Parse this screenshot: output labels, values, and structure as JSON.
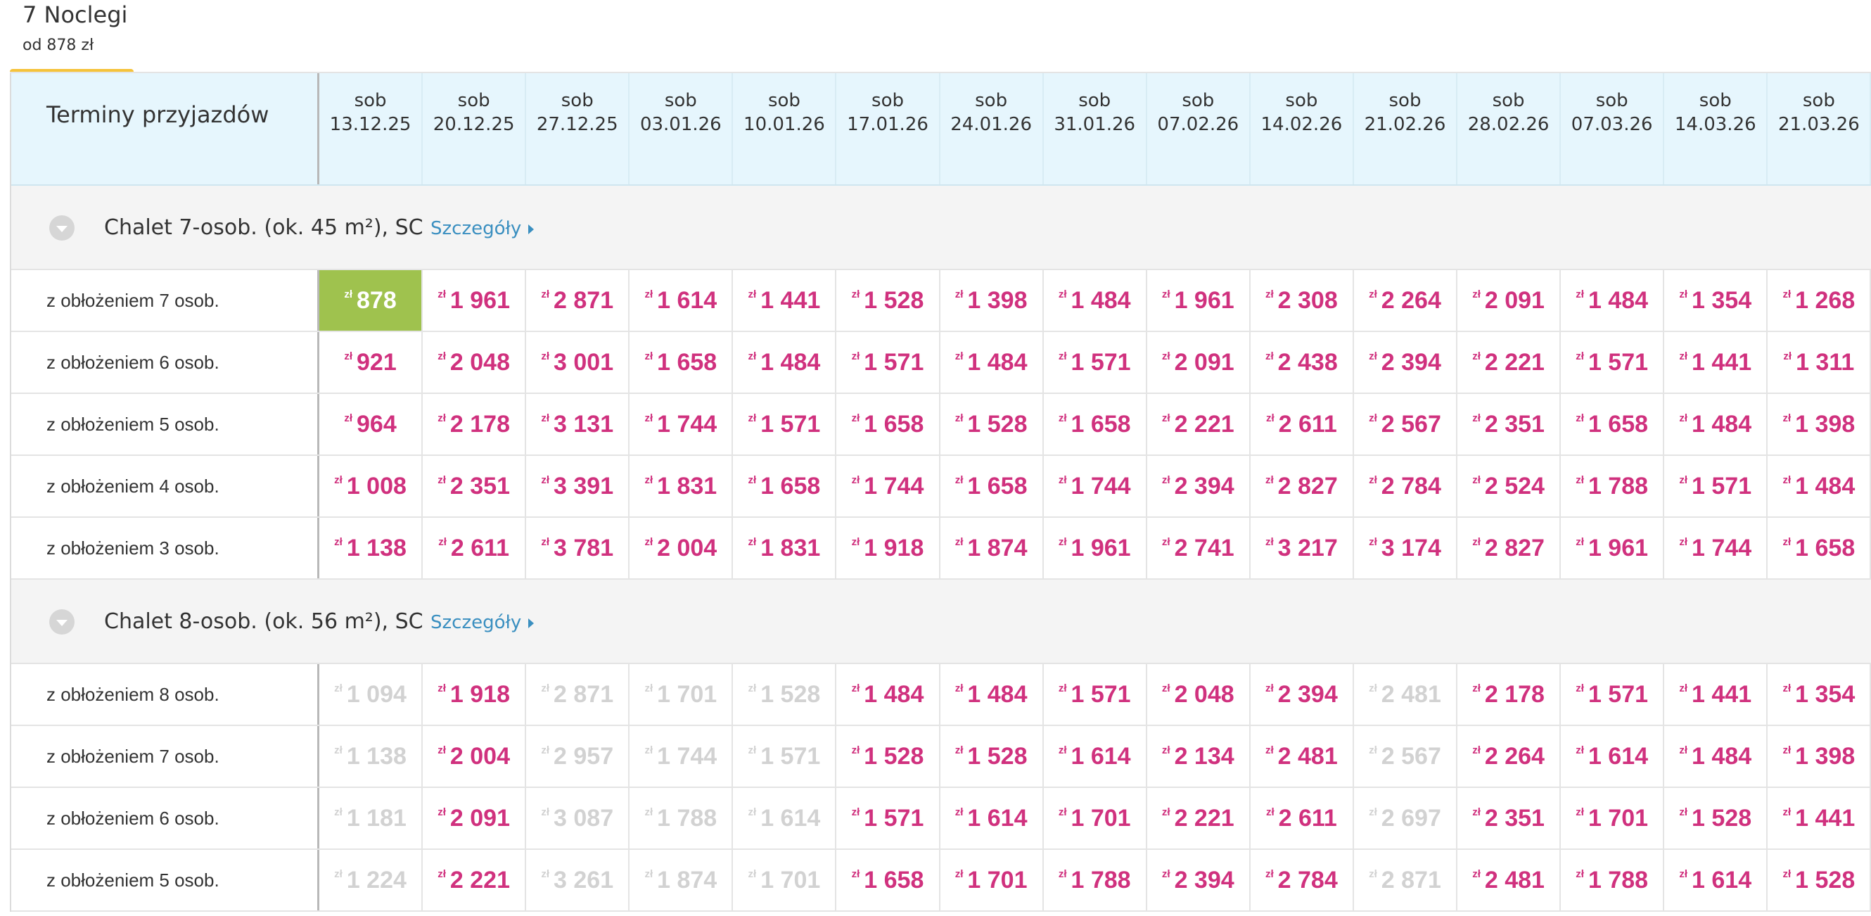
{
  "tab": {
    "title": "7 Noclegi",
    "subtitle": "od 878 zł"
  },
  "colors": {
    "tab_accent": "#f5c33b",
    "price_available": "#d0317e",
    "price_unavailable": "#d2d2d2",
    "best_price_bg": "#9fc24e",
    "header_bg": "#e6f6fd",
    "link": "#3a8fc0"
  },
  "table": {
    "header_label": "Terminy przyjazdów",
    "dates": [
      {
        "day": "sob",
        "date": "13.12.25"
      },
      {
        "day": "sob",
        "date": "20.12.25"
      },
      {
        "day": "sob",
        "date": "27.12.25"
      },
      {
        "day": "sob",
        "date": "03.01.26"
      },
      {
        "day": "sob",
        "date": "10.01.26"
      },
      {
        "day": "sob",
        "date": "17.01.26"
      },
      {
        "day": "sob",
        "date": "24.01.26"
      },
      {
        "day": "sob",
        "date": "31.01.26"
      },
      {
        "day": "sob",
        "date": "07.02.26"
      },
      {
        "day": "sob",
        "date": "14.02.26"
      },
      {
        "day": "sob",
        "date": "21.02.26"
      },
      {
        "day": "sob",
        "date": "28.02.26"
      },
      {
        "day": "sob",
        "date": "07.03.26"
      },
      {
        "day": "sob",
        "date": "14.03.26"
      },
      {
        "day": "sob",
        "date": "21.03.26"
      }
    ],
    "currency": "zł",
    "groups": [
      {
        "title": "Chalet 7-osob. (ok. 45 m²), SC",
        "details_label": "Szczegóły",
        "collapse_icon": "chevron-down-icon",
        "rows": [
          {
            "label": "z obłożeniem 7 osob.",
            "prices": [
              "878",
              "1 961",
              "2 871",
              "1 614",
              "1 441",
              "1 528",
              "1 398",
              "1 484",
              "1 961",
              "2 308",
              "2 264",
              "2 091",
              "1 484",
              "1 354",
              "1 268"
            ],
            "available": [
              1,
              1,
              1,
              1,
              1,
              1,
              1,
              1,
              1,
              1,
              1,
              1,
              1,
              1,
              1
            ],
            "best": 0
          },
          {
            "label": "z obłożeniem 6 osob.",
            "prices": [
              "921",
              "2 048",
              "3 001",
              "1 658",
              "1 484",
              "1 571",
              "1 484",
              "1 571",
              "2 091",
              "2 438",
              "2 394",
              "2 221",
              "1 571",
              "1 441",
              "1 311"
            ],
            "available": [
              1,
              1,
              1,
              1,
              1,
              1,
              1,
              1,
              1,
              1,
              1,
              1,
              1,
              1,
              1
            ]
          },
          {
            "label": "z obłożeniem 5 osob.",
            "prices": [
              "964",
              "2 178",
              "3 131",
              "1 744",
              "1 571",
              "1 658",
              "1 528",
              "1 658",
              "2 221",
              "2 611",
              "2 567",
              "2 351",
              "1 658",
              "1 484",
              "1 398"
            ],
            "available": [
              1,
              1,
              1,
              1,
              1,
              1,
              1,
              1,
              1,
              1,
              1,
              1,
              1,
              1,
              1
            ]
          },
          {
            "label": "z obłożeniem 4 osob.",
            "prices": [
              "1 008",
              "2 351",
              "3 391",
              "1 831",
              "1 658",
              "1 744",
              "1 658",
              "1 744",
              "2 394",
              "2 827",
              "2 784",
              "2 524",
              "1 788",
              "1 571",
              "1 484"
            ],
            "available": [
              1,
              1,
              1,
              1,
              1,
              1,
              1,
              1,
              1,
              1,
              1,
              1,
              1,
              1,
              1
            ]
          },
          {
            "label": "z obłożeniem 3 osob.",
            "prices": [
              "1 138",
              "2 611",
              "3 781",
              "2 004",
              "1 831",
              "1 918",
              "1 874",
              "1 961",
              "2 741",
              "3 217",
              "3 174",
              "2 827",
              "1 961",
              "1 744",
              "1 658"
            ],
            "available": [
              1,
              1,
              1,
              1,
              1,
              1,
              1,
              1,
              1,
              1,
              1,
              1,
              1,
              1,
              1
            ]
          }
        ]
      },
      {
        "title": "Chalet 8-osob. (ok. 56 m²), SC",
        "details_label": "Szczegóły",
        "collapse_icon": "chevron-down-icon",
        "rows": [
          {
            "label": "z obłożeniem 8 osob.",
            "prices": [
              "1 094",
              "1 918",
              "2 871",
              "1 701",
              "1 528",
              "1 484",
              "1 484",
              "1 571",
              "2 048",
              "2 394",
              "2 481",
              "2 178",
              "1 571",
              "1 441",
              "1 354"
            ],
            "available": [
              0,
              1,
              0,
              0,
              0,
              1,
              1,
              1,
              1,
              1,
              0,
              1,
              1,
              1,
              1
            ]
          },
          {
            "label": "z obłożeniem 7 osob.",
            "prices": [
              "1 138",
              "2 004",
              "2 957",
              "1 744",
              "1 571",
              "1 528",
              "1 528",
              "1 614",
              "2 134",
              "2 481",
              "2 567",
              "2 264",
              "1 614",
              "1 484",
              "1 398"
            ],
            "available": [
              0,
              1,
              0,
              0,
              0,
              1,
              1,
              1,
              1,
              1,
              0,
              1,
              1,
              1,
              1
            ]
          },
          {
            "label": "z obłożeniem 6 osob.",
            "prices": [
              "1 181",
              "2 091",
              "3 087",
              "1 788",
              "1 614",
              "1 571",
              "1 614",
              "1 701",
              "2 221",
              "2 611",
              "2 697",
              "2 351",
              "1 701",
              "1 528",
              "1 441"
            ],
            "available": [
              0,
              1,
              0,
              0,
              0,
              1,
              1,
              1,
              1,
              1,
              0,
              1,
              1,
              1,
              1
            ]
          },
          {
            "label": "z obłożeniem 5 osob.",
            "prices": [
              "1 224",
              "2 221",
              "3 261",
              "1 874",
              "1 701",
              "1 658",
              "1 701",
              "1 788",
              "2 394",
              "2 784",
              "2 871",
              "2 481",
              "1 788",
              "1 614",
              "1 528"
            ],
            "available": [
              0,
              1,
              0,
              0,
              0,
              1,
              1,
              1,
              1,
              1,
              0,
              1,
              1,
              1,
              1
            ]
          }
        ]
      }
    ]
  }
}
